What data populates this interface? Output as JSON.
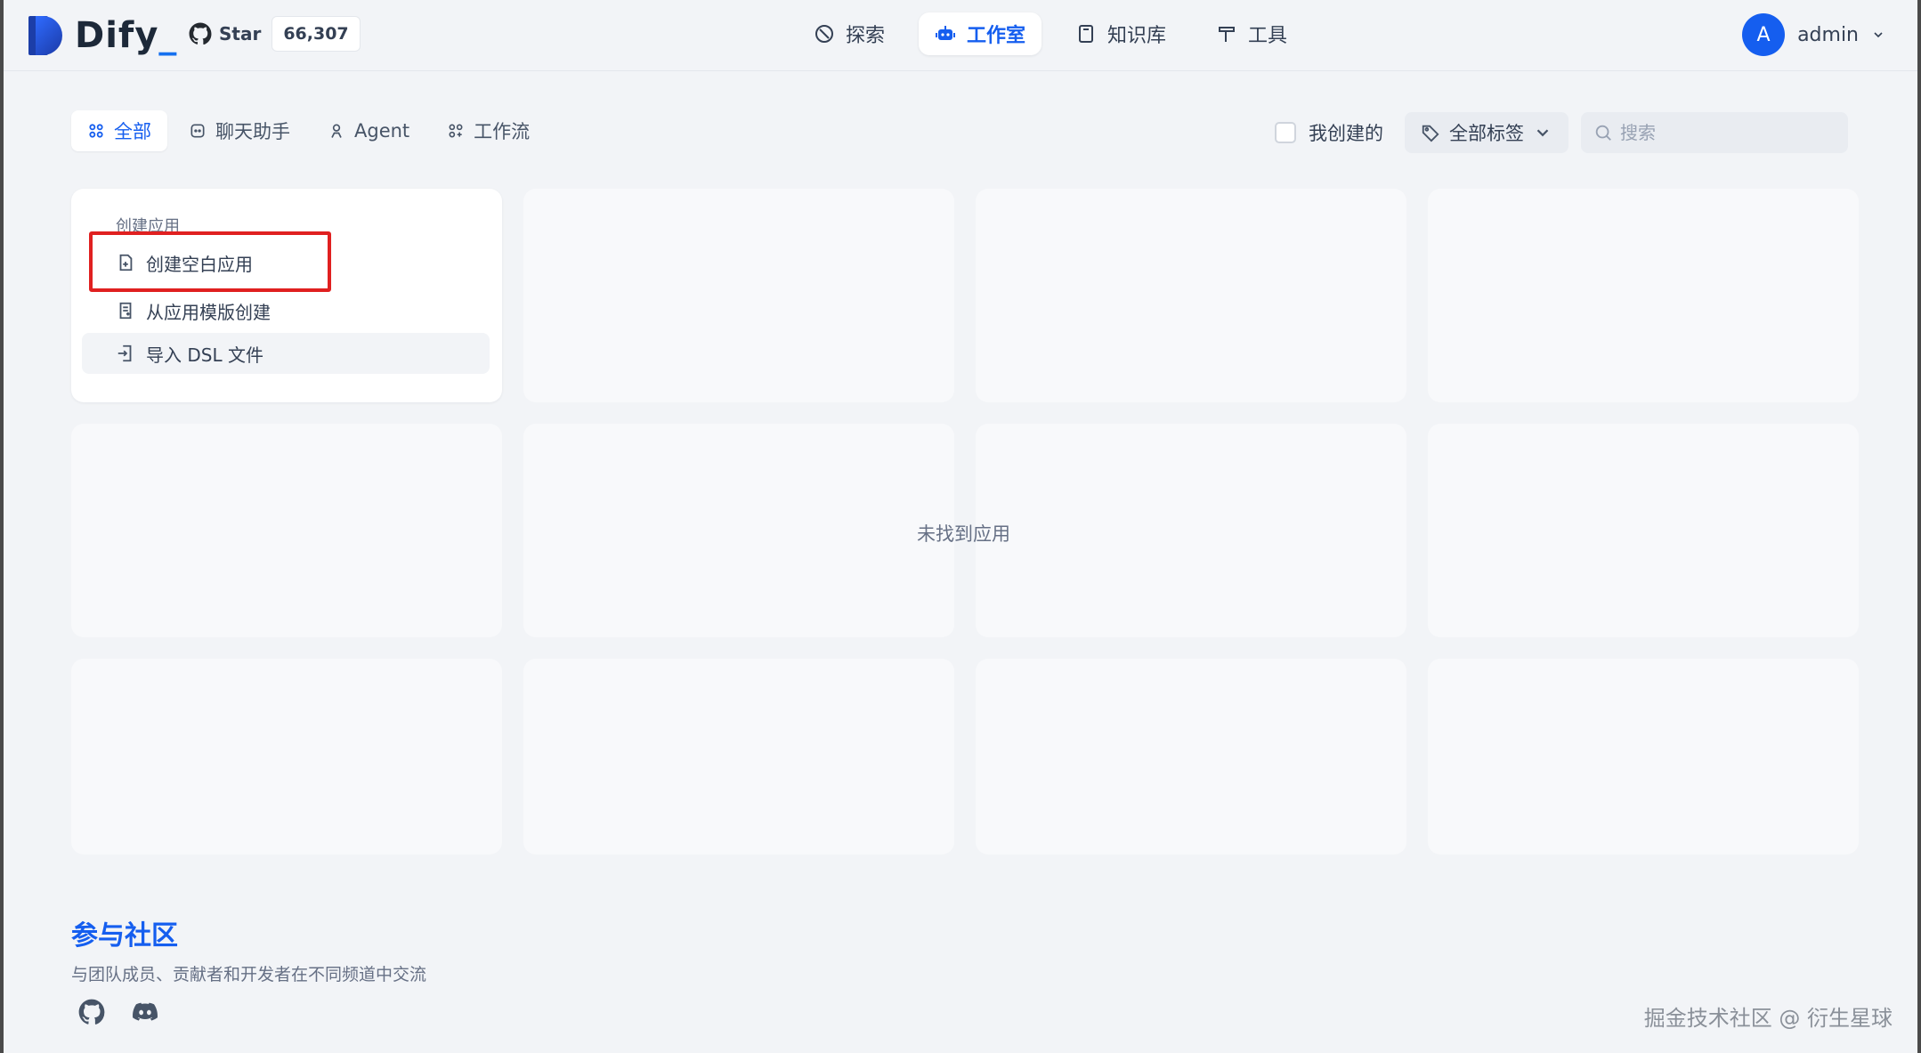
{
  "header": {
    "logo_text": "Dify",
    "github_star_label": "Star",
    "github_star_count": "66,307",
    "nav": [
      {
        "label": "探索",
        "icon": "compass-icon"
      },
      {
        "label": "工作室",
        "icon": "robot-icon"
      },
      {
        "label": "知识库",
        "icon": "book-icon"
      },
      {
        "label": "工具",
        "icon": "hammer-icon"
      }
    ],
    "user": {
      "avatar_initial": "A",
      "name": "admin"
    }
  },
  "toolbar": {
    "tabs": [
      {
        "label": "全部",
        "icon": "grid-icon"
      },
      {
        "label": "聊天助手",
        "icon": "chat-icon"
      },
      {
        "label": "Agent",
        "icon": "agent-icon"
      },
      {
        "label": "工作流",
        "icon": "workflow-icon"
      }
    ],
    "mine_label": "我创建的",
    "tag_select_label": "全部标签",
    "search_placeholder": "搜索"
  },
  "create_card": {
    "title": "创建应用",
    "items": [
      {
        "label": "创建空白应用",
        "icon": "file-plus-icon"
      },
      {
        "label": "从应用模版创建",
        "icon": "template-icon"
      },
      {
        "label": "导入 DSL 文件",
        "icon": "import-icon"
      }
    ]
  },
  "empty_text": "未找到应用",
  "footer": {
    "community_title": "参与社区",
    "community_desc": "与团队成员、贡献者和开发者在不同频道中交流",
    "social": [
      "github-icon",
      "discord-icon"
    ]
  },
  "watermark": "掘金技术社区 @ 衍生星球",
  "colors": {
    "accent": "#155eef",
    "highlight_box": "#e02020"
  }
}
